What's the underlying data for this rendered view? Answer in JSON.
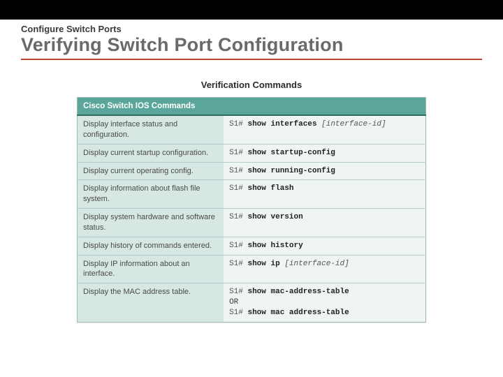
{
  "header": {
    "kicker": "Configure Switch Ports",
    "title": "Verifying Switch Port Configuration"
  },
  "table": {
    "caption": "Verification Commands",
    "header": "Cisco Switch IOS Commands",
    "prompt": "S1#",
    "or": "OR",
    "rows": [
      {
        "desc": "Display interface status and configuration.",
        "cmd": {
          "kw": "show interfaces",
          "arg": "[interface-id]"
        }
      },
      {
        "desc": "Display current startup configuration.",
        "cmd": {
          "kw": "show startup-config"
        }
      },
      {
        "desc": "Display current operating config.",
        "cmd": {
          "kw": "show running-config"
        }
      },
      {
        "desc": "Display information about flash file system.",
        "cmd": {
          "kw": "show flash"
        }
      },
      {
        "desc": "Display system hardware and software status.",
        "cmd": {
          "kw": "show version"
        }
      },
      {
        "desc": "Display history of commands entered.",
        "cmd": {
          "kw": "show history"
        }
      },
      {
        "desc": "Display IP information about an interface.",
        "cmd": {
          "kw": "show ip",
          "arg": "[interface-id]"
        }
      },
      {
        "desc": "Display the MAC address table.",
        "cmd": {
          "kw": "show mac-address-table"
        },
        "alt": {
          "kw": "show mac address-table"
        }
      }
    ]
  }
}
